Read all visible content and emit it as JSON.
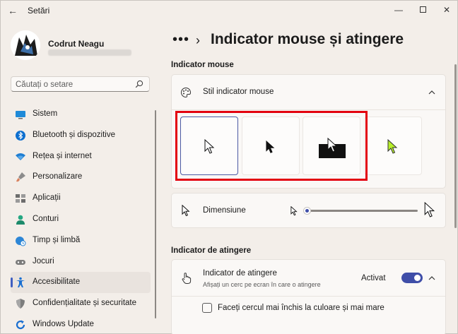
{
  "window": {
    "title": "Setări"
  },
  "user": {
    "name": "Codrut Neagu"
  },
  "search": {
    "placeholder": "Căutați o setare"
  },
  "sidebar": {
    "items": [
      {
        "label": "Sistem",
        "icon": "monitor-icon",
        "color": "#0078d4"
      },
      {
        "label": "Bluetooth și dispozitive",
        "icon": "bluetooth-icon",
        "color": "#0078d4"
      },
      {
        "label": "Rețea și internet",
        "icon": "wifi-icon",
        "color": "#0078d4"
      },
      {
        "label": "Personalizare",
        "icon": "brush-icon",
        "color": "#c1785a"
      },
      {
        "label": "Aplicații",
        "icon": "apps-icon",
        "color": "#6b6b6b"
      },
      {
        "label": "Conturi",
        "icon": "person-icon",
        "color": "#21a07a"
      },
      {
        "label": "Timp și limbă",
        "icon": "globe-clock-icon",
        "color": "#2a7fd4"
      },
      {
        "label": "Jocuri",
        "icon": "gamepad-icon",
        "color": "#6b6b6b"
      },
      {
        "label": "Accesibilitate",
        "icon": "accessibility-icon",
        "color": "#1a6fd1",
        "selected": true
      },
      {
        "label": "Confidențialitate și securitate",
        "icon": "shield-icon",
        "color": "#6b6b6b"
      },
      {
        "label": "Windows Update",
        "icon": "update-icon",
        "color": "#1a6fd1"
      }
    ]
  },
  "breadcrumb": {
    "dots": "•••",
    "separator": "›",
    "title": "Indicator mouse și atingere"
  },
  "mouse_section": {
    "heading": "Indicator mouse",
    "style_row": {
      "label": "Stil indicator mouse"
    },
    "styles": [
      {
        "name": "white",
        "selected": true
      },
      {
        "name": "black",
        "selected": false
      },
      {
        "name": "inverted",
        "selected": false
      },
      {
        "name": "custom",
        "selected": false,
        "color": "#b7ef2a"
      }
    ],
    "size_row": {
      "label": "Dimensiune",
      "value_fraction": 0.0
    }
  },
  "touch_section": {
    "heading": "Indicator de atingere",
    "touch_row": {
      "label": "Indicator de atingere",
      "sublabel": "Afișați un cerc pe ecran în care o atingere",
      "state_label": "Activat",
      "on": true
    },
    "checkbox": {
      "label": "Faceți cercul mai închis la culoare și mai mare",
      "checked": false
    }
  },
  "colors": {
    "accent": "#3f4ea8",
    "highlight": "#e3000f"
  }
}
